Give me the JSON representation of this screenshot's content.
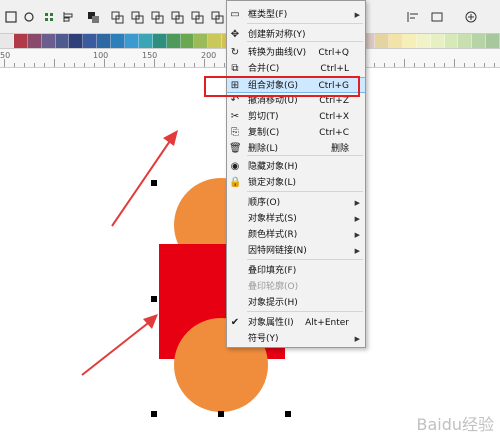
{
  "menu": {
    "items": [
      {
        "label": "框类型(F)",
        "icon": "frame-type-icon",
        "submenu": true
      },
      {
        "label": "创建新对称(Y)",
        "icon": "symmetry-icon"
      },
      {
        "label": "转换为曲线(V)",
        "icon": "convert-curve-icon",
        "shortcut": "Ctrl+Q"
      },
      {
        "label": "合并(C)",
        "icon": "combine-icon",
        "shortcut": "Ctrl+L"
      },
      {
        "label": "组合对象(G)",
        "icon": "group-objects-icon",
        "shortcut": "Ctrl+G",
        "highlight": true
      },
      {
        "label": "撤消移动(U)",
        "icon": "undo-icon",
        "shortcut": "Ctrl+Z"
      },
      {
        "label": "剪切(T)",
        "icon": "cut-icon",
        "shortcut": "Ctrl+X"
      },
      {
        "label": "复制(C)",
        "icon": "copy-icon",
        "shortcut": "Ctrl+C"
      },
      {
        "label": "删除(L)",
        "icon": "delete-icon",
        "shortcut": "删除"
      },
      {
        "label": "隐藏对象(H)",
        "icon": "hide-icon"
      },
      {
        "label": "锁定对象(L)",
        "icon": "lock-icon"
      },
      {
        "label": "顺序(O)",
        "submenu": true
      },
      {
        "label": "对象样式(S)",
        "submenu": true
      },
      {
        "label": "颜色样式(R)",
        "submenu": true
      },
      {
        "label": "因特网链接(N)",
        "submenu": true
      },
      {
        "label": "叠印填充(F)"
      },
      {
        "label": "叠印轮廓(O)",
        "disabled": true
      },
      {
        "label": "对象提示(H)"
      },
      {
        "label": "对象属性(I)",
        "icon": "checkmark-icon",
        "shortcut": "Alt+Enter"
      },
      {
        "label": "符号(Y)",
        "submenu": true
      }
    ]
  },
  "ruler": {
    "labels": [
      "50",
      "100",
      "150",
      "200"
    ]
  },
  "palette": {
    "colors": [
      "#e8e8e8",
      "#b23a48",
      "#8a4a6b",
      "#6b5e8f",
      "#4e5b8c",
      "#2f3f7a",
      "#3c5a9e",
      "#2d6aa3",
      "#2c7fb8",
      "#3b9acf",
      "#3aa6b5",
      "#2f8f7e",
      "#4f9a5a",
      "#6aa84f",
      "#9bbb59",
      "#c9c85a",
      "#d8c24e",
      "#c59a3d",
      "#a8723a",
      "#8c5a3c",
      "#7a4a48",
      "#5a4a5e",
      "#6e6e9a",
      "#8a8abf",
      "#a7a7d6",
      "#c9bfd8",
      "#d9c7c0",
      "#e5d3a0",
      "#f2e3a6",
      "#f6efb8",
      "#eff3c7",
      "#e6f0c3",
      "#d7e9b9",
      "#c9dfb1",
      "#b7d4a6",
      "#a6c89c"
    ]
  },
  "colors": {
    "orange": "#f08d3c",
    "red": "#e60012",
    "arrow": "#e23b3b",
    "highlight": "#cde8ff"
  },
  "watermark": "Baidu经验"
}
